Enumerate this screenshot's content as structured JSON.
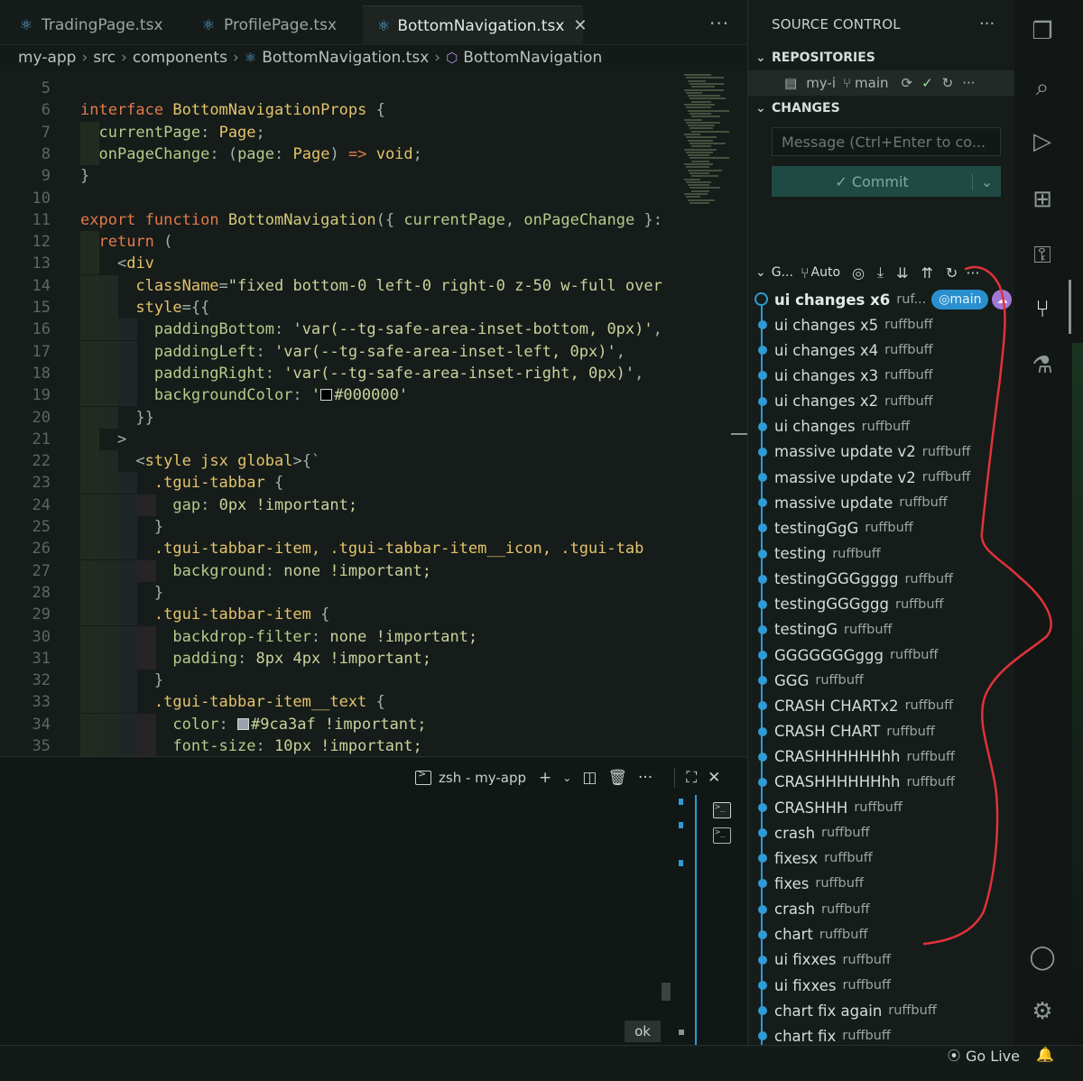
{
  "tabs": [
    {
      "label": "TradingPage.tsx",
      "active": false
    },
    {
      "label": "ProfilePage.tsx",
      "active": false
    },
    {
      "label": "BottomNavigation.tsx",
      "active": true
    }
  ],
  "breadcrumb": [
    "my-app",
    "src",
    "components",
    "BottomNavigation.tsx",
    "BottomNavigation"
  ],
  "code_lines": [
    {
      "n": "5",
      "html": ""
    },
    {
      "n": "6",
      "html": "<span class='k'>interface</span> <span class='t'>BottomNavigationProps</span> <span class='pu'>{</span>"
    },
    {
      "n": "7",
      "html": "  <span class='p'>currentPage</span><span class='pu'>:</span> <span class='t'>Page</span><span class='pu'>;</span>"
    },
    {
      "n": "8",
      "html": "  <span class='p'>onPageChange</span><span class='pu'>:</span> <span class='pu'>(</span><span class='p'>page</span><span class='pu'>:</span> <span class='t'>Page</span><span class='pu'>)</span> <span class='k'>=></span> <span class='t'>void</span><span class='pu'>;</span>"
    },
    {
      "n": "9",
      "html": "<span class='pu'>}</span>"
    },
    {
      "n": "10",
      "html": ""
    },
    {
      "n": "11",
      "html": "<span class='k'>export</span> <span class='k'>function</span> <span class='f'>BottomNavigation</span><span class='pu'>({</span> <span class='p'>currentPage</span><span class='pu'>,</span> <span class='p'>onPageChange</span> <span class='pu'>}:</span>"
    },
    {
      "n": "12",
      "html": "  <span class='k'>return</span> <span class='pu'>(</span>"
    },
    {
      "n": "13",
      "html": "    <span class='pu'>&lt;</span><span class='t'>div</span>"
    },
    {
      "n": "14",
      "html": "      <span class='t'>className</span><span class='pu'>=</span><span class='s'>\"fixed bottom-0 left-0 right-0 z-50 w-full over</span>"
    },
    {
      "n": "15",
      "html": "      <span class='t'>style</span><span class='pu'>={{</span>"
    },
    {
      "n": "16",
      "html": "        <span class='p'>paddingBottom</span><span class='pu'>:</span> <span class='s'>'var(--tg-safe-area-inset-bottom, 0px)'</span><span class='pu'>,</span>"
    },
    {
      "n": "17",
      "html": "        <span class='p'>paddingLeft</span><span class='pu'>:</span> <span class='s'>'var(--tg-safe-area-inset-left, 0px)'</span><span class='pu'>,</span>"
    },
    {
      "n": "18",
      "html": "        <span class='p'>paddingRight</span><span class='pu'>:</span> <span class='s'>'var(--tg-safe-area-inset-right, 0px)'</span><span class='pu'>,</span>"
    },
    {
      "n": "19",
      "html": "        <span class='p'>backgroundColor</span><span class='pu'>:</span> <span class='s'>'<span class='swatch' style='background:#000000'></span>#000000'</span>"
    },
    {
      "n": "20",
      "html": "      <span class='pu'>}}</span>"
    },
    {
      "n": "21",
      "html": "    <span class='pu'>></span>"
    },
    {
      "n": "22",
      "html": "      <span class='pu'>&lt;</span><span class='t'>style</span> <span class='t'>jsx</span> <span class='t'>global</span><span class='pu'>>{`</span>"
    },
    {
      "n": "23",
      "html": "        <span class='sel'>.tgui-tabbar</span> <span class='pu'>{</span>"
    },
    {
      "n": "24",
      "html": "          <span class='p'>gap</span><span class='pu'>:</span> <span class='s'>0px !important;</span>"
    },
    {
      "n": "25",
      "html": "        <span class='pu'>}</span>"
    },
    {
      "n": "26",
      "html": "        <span class='sel'>.tgui-tabbar-item, .tgui-tabbar-item__icon, .tgui-tab</span>"
    },
    {
      "n": "27",
      "html": "          <span class='p'>background</span><span class='pu'>:</span> <span class='s'>none !important;</span>"
    },
    {
      "n": "28",
      "html": "        <span class='pu'>}</span>"
    },
    {
      "n": "29",
      "html": "        <span class='sel'>.tgui-tabbar-item</span> <span class='pu'>{</span>"
    },
    {
      "n": "30",
      "html": "          <span class='p'>backdrop-filter</span><span class='pu'>:</span> <span class='s'>none !important;</span>"
    },
    {
      "n": "31",
      "html": "          <span class='p'>padding</span><span class='pu'>:</span> <span class='s'>8px 4px !important;</span>"
    },
    {
      "n": "32",
      "html": "        <span class='pu'>}</span>"
    },
    {
      "n": "33",
      "html": "        <span class='sel'>.tgui-tabbar-item__text</span> <span class='pu'>{</span>"
    },
    {
      "n": "34",
      "html": "          <span class='p'>color</span><span class='pu'>:</span> <span class='s'><span class='swatch' style='background:#9ca3af'></span>#9ca3af !important;</span>"
    },
    {
      "n": "35",
      "html": "          <span class='p'>font-size</span><span class='pu'>:</span> <span class='s'>10px !important;</span>"
    }
  ],
  "terminal": {
    "title": "zsh - my-app",
    "status": "ok"
  },
  "scm": {
    "title": "SOURCE CONTROL",
    "repositories_label": "REPOSITORIES",
    "repo_name": "my-i",
    "repo_branch": "main",
    "changes_label": "CHANGES",
    "message_placeholder": "Message (Ctrl+Enter to co...",
    "commit_label": "✓ Commit",
    "graph_label": "G...",
    "graph_auto": "Auto",
    "head_branch": "main",
    "commits": [
      {
        "msg": "ui changes x6",
        "author": "ruf...",
        "head": true
      },
      {
        "msg": "ui changes x5",
        "author": "ruffbuff"
      },
      {
        "msg": "ui changes x4",
        "author": "ruffbuff"
      },
      {
        "msg": "ui changes x3",
        "author": "ruffbuff"
      },
      {
        "msg": "ui changes x2",
        "author": "ruffbuff"
      },
      {
        "msg": "ui changes",
        "author": "ruffbuff"
      },
      {
        "msg": "massive update v2",
        "author": "ruffbuff"
      },
      {
        "msg": "massive update v2",
        "author": "ruffbuff"
      },
      {
        "msg": "massive update",
        "author": "ruffbuff"
      },
      {
        "msg": "testingGgG",
        "author": "ruffbuff"
      },
      {
        "msg": "testing",
        "author": "ruffbuff"
      },
      {
        "msg": "testingGGGgggg",
        "author": "ruffbuff"
      },
      {
        "msg": "testingGGGggg",
        "author": "ruffbuff"
      },
      {
        "msg": "testingG",
        "author": "ruffbuff"
      },
      {
        "msg": "GGGGGGGggg",
        "author": "ruffbuff"
      },
      {
        "msg": "GGG",
        "author": "ruffbuff"
      },
      {
        "msg": "CRASH CHARTx2",
        "author": "ruffbuff"
      },
      {
        "msg": "CRASH CHART",
        "author": "ruffbuff"
      },
      {
        "msg": "CRASHHHHHHhh",
        "author": "ruffbuff"
      },
      {
        "msg": "CRASHHHHHHhh",
        "author": "ruffbuff"
      },
      {
        "msg": "CRASHHH",
        "author": "ruffbuff"
      },
      {
        "msg": "crash",
        "author": "ruffbuff"
      },
      {
        "msg": "fixesx",
        "author": "ruffbuff"
      },
      {
        "msg": "fixes",
        "author": "ruffbuff"
      },
      {
        "msg": "crash",
        "author": "ruffbuff"
      },
      {
        "msg": "chart",
        "author": "ruffbuff"
      },
      {
        "msg": "ui fixxes",
        "author": "ruffbuff"
      },
      {
        "msg": "ui fixxes",
        "author": "ruffbuff"
      },
      {
        "msg": "chart fix again",
        "author": "ruffbuff"
      },
      {
        "msg": "chart fix",
        "author": "ruffbuff"
      }
    ]
  },
  "statusbar": {
    "golive": "Go Live"
  },
  "colors": {
    "accent_blue": "#2f9bd6",
    "annotation_red": "#e0323a",
    "commit_button": "#1f4a44"
  }
}
